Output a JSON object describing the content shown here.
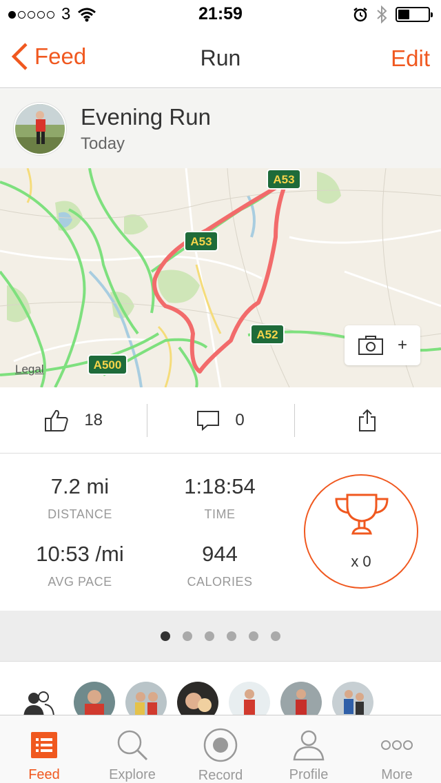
{
  "status_bar": {
    "carrier": "3",
    "time": "21:59"
  },
  "nav": {
    "back_label": "Feed",
    "title": "Run",
    "edit_label": "Edit"
  },
  "activity": {
    "title": "Evening Run",
    "date": "Today"
  },
  "map": {
    "legal": "Legal",
    "road_labels": [
      "A53",
      "A53",
      "A52",
      "A500"
    ],
    "photo_plus": "+"
  },
  "social": {
    "kudos_count": "18",
    "comment_count": "0"
  },
  "stats": {
    "distance": {
      "value": "7.2 mi",
      "label": "DISTANCE"
    },
    "time": {
      "value": "1:18:54",
      "label": "TIME"
    },
    "pace": {
      "value": "10:53 /mi",
      "label": "AVG PACE"
    },
    "calories": {
      "value": "944",
      "label": "CALORIES"
    },
    "achievements": "x 0"
  },
  "pager": {
    "count": 6,
    "active": 0
  },
  "tabs": [
    {
      "label": "Feed"
    },
    {
      "label": "Explore"
    },
    {
      "label": "Record"
    },
    {
      "label": "Profile"
    },
    {
      "label": "More"
    }
  ],
  "colors": {
    "accent": "#f0581f",
    "route": "#f26b6b",
    "road": "#7ee07e"
  }
}
